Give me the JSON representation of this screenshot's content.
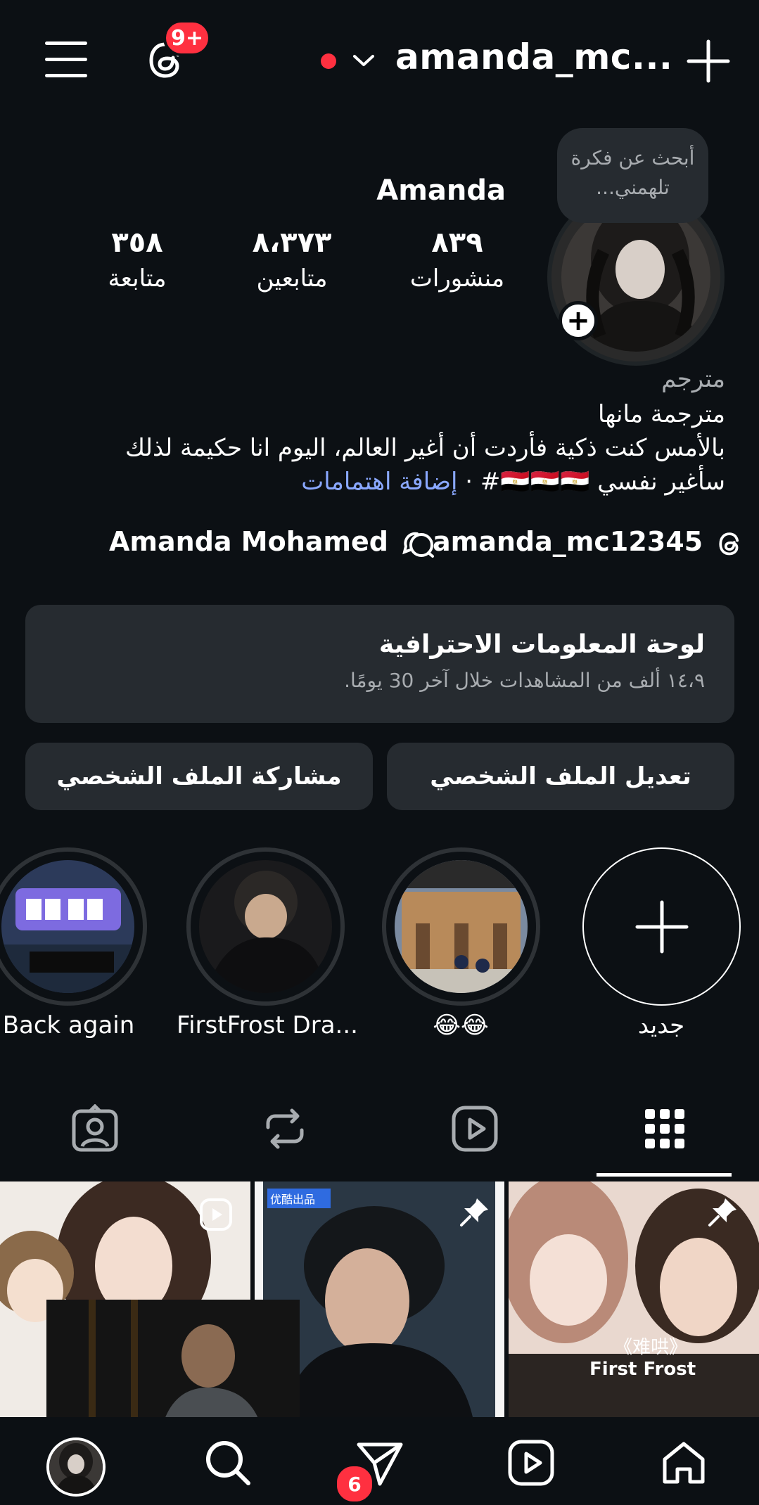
{
  "header": {
    "username": "amanda_mc...",
    "threads_badge": "9+"
  },
  "profile": {
    "note": "أبحث عن فكرة تلهمني...",
    "display_name": "Amanda",
    "stats": [
      {
        "value": "٨٣٩",
        "label": "منشورات"
      },
      {
        "value": "٨،٣٧٣",
        "label": "متابعين"
      },
      {
        "value": "٣٥٨",
        "label": "متابعة"
      }
    ],
    "category": "مترجم",
    "bio_lines": [
      "مترجمة مانها",
      "بالأمس كنت ذكية فأردت أن أغير العالم، اليوم انا حكيمة لذلك",
      "سأغير نفسي 🇪🇬🇪🇬🇪🇬#"
    ],
    "bio_link_sep": " · ",
    "add_interests": "إضافة اهتمامات",
    "threads_handle": "amanda_mc12345",
    "linked_name": "Amanda Mohamed"
  },
  "dashboard": {
    "title": "لوحة المعلومات الاحترافية",
    "subtitle": "١٤،٩ ألف من المشاهدات خلال آخر 30 يومًا."
  },
  "buttons": {
    "edit": "تعديل الملف الشخصي",
    "share": "مشاركة الملف الشخصي"
  },
  "highlights": [
    {
      "label": "Back again"
    },
    {
      "label": "FirstFrost Dra..."
    },
    {
      "label": "😂😂"
    },
    {
      "label": "جديد"
    }
  ],
  "grid": {
    "tile3_text": "《难哄》",
    "tile3_sub": "First Frost",
    "tile2_tag": "优酷出品"
  },
  "bottom_nav": {
    "messages_badge": "6"
  },
  "colors": {
    "background": "#0c1014",
    "card": "#262b30",
    "badge": "#ff3040",
    "link": "#8aa8ff"
  }
}
